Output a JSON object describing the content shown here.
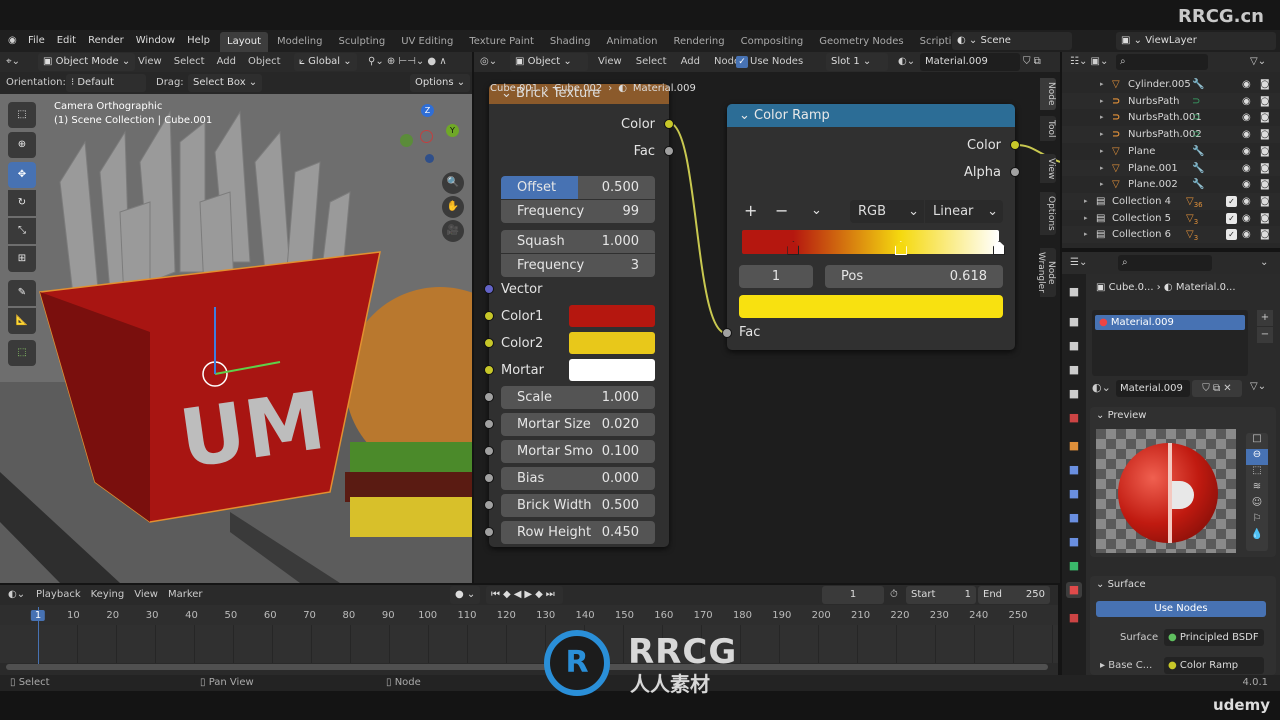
{
  "watermarks": {
    "top_right": "RRCG.cn",
    "center_title": "RRCG",
    "center_sub": "人人素材",
    "udemy": "udemy"
  },
  "menu": {
    "items": [
      "File",
      "Edit",
      "Render",
      "Window",
      "Help"
    ]
  },
  "workspaces": {
    "tabs": [
      "Layout",
      "Modeling",
      "Sculpting",
      "UV Editing",
      "Texture Paint",
      "Shading",
      "Animation",
      "Rendering",
      "Compositing",
      "Geometry Nodes",
      "Scripting"
    ],
    "active": "Layout",
    "add": "+"
  },
  "scene": {
    "name": "Scene",
    "view_layer": "ViewLayer"
  },
  "viewport": {
    "mode": "Object Mode",
    "menus": [
      "View",
      "Select",
      "Add",
      "Object"
    ],
    "transform": "Global",
    "orientation_label": "Orientation:",
    "orientation": "Default",
    "drag_label": "Drag:",
    "drag": "Select Box",
    "options": "Options",
    "overlay_title": "Camera Orthographic",
    "overlay_sub": "(1) Scene Collection | Cube.001",
    "gizmo": {
      "z": "Z",
      "y": "Y"
    }
  },
  "node_editor": {
    "type": "Object",
    "menus": [
      "View",
      "Select",
      "Add",
      "Node"
    ],
    "use_nodes_label": "Use Nodes",
    "use_nodes": true,
    "slot": "Slot 1",
    "material": "Material.009",
    "breadcrumb": [
      "Cube.001",
      "Cube.002",
      "Material.009"
    ],
    "side_tabs": [
      "Node",
      "Tool",
      "View",
      "Options",
      "Node Wrangler"
    ],
    "brick": {
      "title": "Brick Texture",
      "color_header": "#8b5a2b",
      "outputs": [
        "Color",
        "Fac"
      ],
      "fields": [
        {
          "label": "Offset",
          "value": "0.500",
          "fill": 0.5
        },
        {
          "label": "Frequency",
          "value": "99"
        },
        {
          "label": "Squash",
          "value": "1.000"
        },
        {
          "label": "Frequency",
          "value": "3"
        }
      ],
      "vector": "Vector",
      "colors": [
        {
          "label": "Color1",
          "value": "#b5170f"
        },
        {
          "label": "Color2",
          "value": "#e8c81a"
        },
        {
          "label": "Mortar",
          "value": "#ffffff"
        }
      ],
      "params": [
        {
          "label": "Scale",
          "value": "1.000"
        },
        {
          "label": "Mortar Size",
          "value": "0.020"
        },
        {
          "label": "Mortar Smo",
          "value": "0.100"
        },
        {
          "label": "Bias",
          "value": "0.000"
        },
        {
          "label": "Brick Width",
          "value": "0.500"
        },
        {
          "label": "Row Height",
          "value": "0.450"
        }
      ]
    },
    "ramp": {
      "title": "Color Ramp",
      "color_header": "#2c6d96",
      "outputs": [
        "Color",
        "Alpha"
      ],
      "add": "+",
      "remove": "−",
      "color_mode": "RGB",
      "interpolation": "Linear",
      "stops": [
        {
          "pos": 0.2,
          "color": "#b5170f"
        },
        {
          "pos": 0.618,
          "color": "#f5d90f"
        },
        {
          "pos": 1.0,
          "color": "#ffffff"
        }
      ],
      "active_index": "1",
      "pos_label": "Pos",
      "pos_value": "0.618",
      "active_color": "#f8e110",
      "input": "Fac"
    }
  },
  "outliner": {
    "rows": [
      {
        "name": "Cylinder.005",
        "type": "mesh",
        "indent": 1
      },
      {
        "name": "NurbsPath",
        "type": "curve",
        "indent": 1
      },
      {
        "name": "NurbsPath.001",
        "type": "curve",
        "indent": 1
      },
      {
        "name": "NurbsPath.002",
        "type": "curve",
        "indent": 1
      },
      {
        "name": "Plane",
        "type": "mesh",
        "indent": 1
      },
      {
        "name": "Plane.001",
        "type": "mesh",
        "indent": 1
      },
      {
        "name": "Plane.002",
        "type": "mesh",
        "indent": 1
      },
      {
        "name": "Collection 4",
        "type": "collection",
        "indent": 0,
        "count": "36"
      },
      {
        "name": "Collection 5",
        "type": "collection",
        "indent": 0,
        "count": "3"
      },
      {
        "name": "Collection 6",
        "type": "collection",
        "indent": 0,
        "count": "3"
      }
    ]
  },
  "properties": {
    "breadcrumb": [
      "Cube.0...",
      "Material.0..."
    ],
    "slots": [
      "Material.009"
    ],
    "material": "Material.009",
    "preview_label": "Preview",
    "surface_label": "Surface",
    "use_nodes": "Use Nodes",
    "surface_field_label": "Surface",
    "surface_value": "Principled BSDF",
    "base_color_label": "Base C...",
    "base_color_value": "Color Ramp"
  },
  "timeline": {
    "menus": [
      "Playback",
      "Keying",
      "View",
      "Marker"
    ],
    "current_frame": "1",
    "start_label": "Start",
    "start": "1",
    "end_label": "End",
    "end": "250",
    "ticks": [
      "1",
      "10",
      "20",
      "30",
      "40",
      "50",
      "60",
      "70",
      "80",
      "90",
      "100",
      "110",
      "120",
      "130",
      "140",
      "150",
      "160",
      "170",
      "180",
      "190",
      "200",
      "210",
      "220",
      "230",
      "240",
      "250"
    ]
  },
  "statusbar": {
    "items": [
      "Select",
      "Pan View",
      "Node"
    ],
    "version": "4.0.1"
  }
}
